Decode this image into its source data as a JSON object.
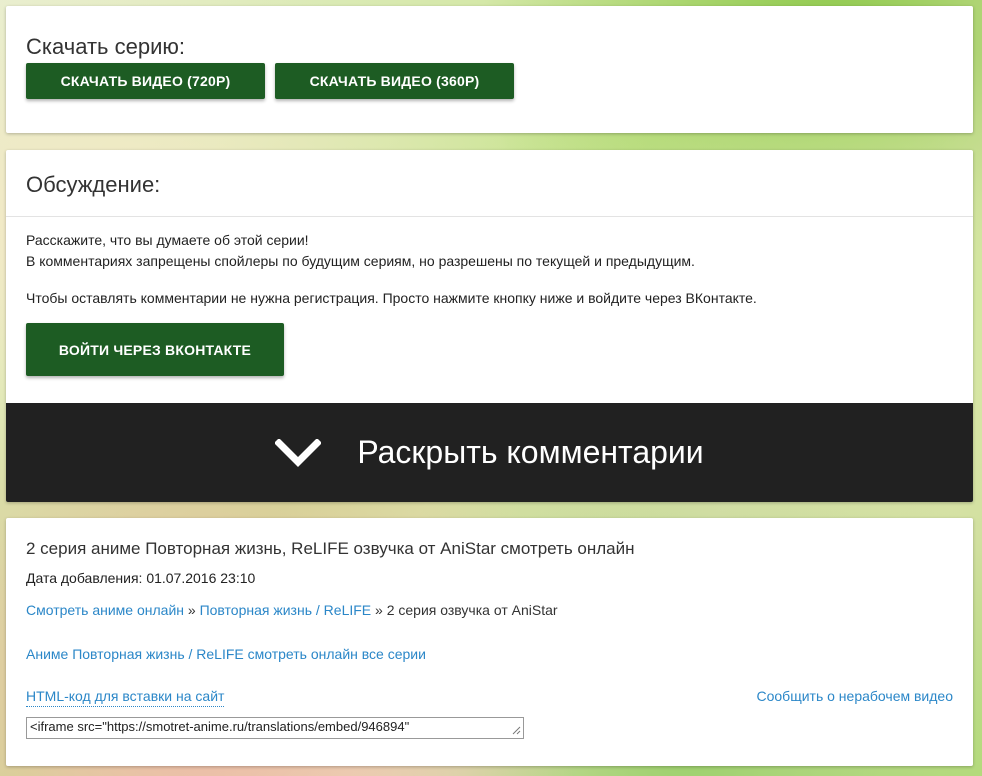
{
  "download": {
    "title": "Скачать серию:",
    "btn_720": "Скачать видео (720p)",
    "btn_360": "Скачать видео (360p)"
  },
  "discussion": {
    "title": "Обсуждение:",
    "line1": "Расскажите, что вы думаете об этой серии!",
    "line2": "В комментариях запрещены спойлеры по будущим сериям, но разрешены по текущей и предыдущим.",
    "line3": "Чтобы оставлять комментарии не нужна регистрация. Просто нажмите кнопку ниже и войдите через ВКонтакте.",
    "vk_button": "Войти через ВКонтакте",
    "expand_label": "Раскрыть комментарии",
    "expand_icon": "chevron-down-icon"
  },
  "info": {
    "title": "2 серия аниме Повторная жизнь, ReLIFE озвучка от AniStar смотреть онлайн",
    "date": "Дата добавления: 01.07.2016 23:10",
    "breadcrumb": {
      "home": "Смотреть аниме онлайн",
      "separator": "»",
      "series": "Повторная жизнь / ReLIFE",
      "current": "2 серия озвучка от AniStar"
    },
    "all_series_link": "Аниме Повторная жизнь / ReLIFE смотреть онлайн все серии",
    "html_code_link": "HTML-код для вставки на сайт",
    "report_link": "Сообщить о нерабочем видео",
    "embed_code": "<iframe src=\"https://smotret-anime.ru/translations/embed/946894\""
  },
  "colors": {
    "button_green": "#1d5c23",
    "link_blue": "#2b87c8",
    "expand_bar": "#212121"
  }
}
